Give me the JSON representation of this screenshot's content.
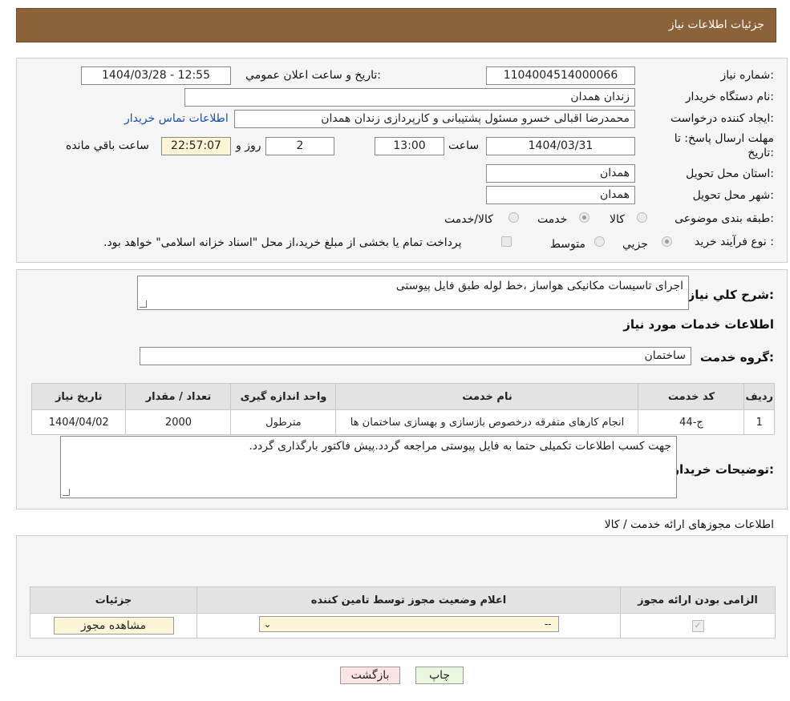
{
  "header": {
    "title": "جزئیات اطلاعات نیاز"
  },
  "info": {
    "need_number_label": "شماره نیاز:",
    "need_number": "1104004514000066",
    "announce_label": "تاریخ و ساعت اعلان عمومي:",
    "announce_value": "1404/03/28 - 12:55",
    "buyer_org_label": "نام دستگاه خريدار:",
    "buyer_org": "زندان همدان",
    "requester_label": "ايجاد کننده درخواست:",
    "requester": "محمدرضا اقبالی خسرو مسئول پشتیبانی و کارپردازی زندان همدان",
    "contact_link": "اطلاعات تماس خريدار",
    "deadline_label_1": "مهلت ارسال پاسخ: تا",
    "deadline_label_2": "تاريخ:",
    "deadline_date": "1404/03/31",
    "time_label": "ساعت",
    "deadline_time": "13:00",
    "days": "2",
    "days_label": "روز و",
    "remaining": "22:57:07",
    "remaining_label": "ساعت باقي مانده",
    "province_label": "استان محل تحويل:",
    "province": "همدان",
    "city_label": "شهر محل تحويل:",
    "city": "همدان",
    "category_label": "طبقه بندی موضوعی:",
    "category_options": [
      "کالا",
      "خدمت",
      "کالا/خدمت"
    ],
    "category_selected": 1,
    "process_label": "نوع فرآيند خريد :",
    "process_options": [
      "جزيي",
      "متوسط"
    ],
    "process_note": "پرداخت تمام يا بخشی از مبلغ خريد،از محل \"اسناد خزانه اسلامی\" خواهد بود."
  },
  "details": {
    "summary_label": "شرح کلي نياز:",
    "summary": "اجرای تاسیسات مکانیکی هواساز ،خط لوله طبق فایل پیوستی",
    "services_title": "اطلاعات خدمات مورد نياز",
    "service_group_label": "گروه خدمت:",
    "service_group": "ساختمان",
    "table": {
      "headers": [
        "رديف",
        "کد خدمت",
        "نام خدمت",
        "واحد اندازه گيری",
        "تعداد / مقدار",
        "تاريخ نياز"
      ],
      "rows": [
        [
          "1",
          "ج-44",
          "انجام کارهای متفرقه درخصوص بازسازی و بهسازی ساختمان ها",
          "مترطول",
          "2000",
          "1404/04/02"
        ]
      ]
    },
    "buyer_notes_label": "توضيحات خريدار:",
    "buyer_notes": "جهت کسب اطلاعات تکمیلی حتما به فایل پیوستی مراجعه گردد.پیش فاکتور بارگذاری گردد."
  },
  "permits": {
    "title": "اطلاعات مجوزهای ارائه خدمت / کالا",
    "headers": [
      "الزامی بودن ارائه مجوز",
      "اعلام وضعيت مجوز توسط تامين کننده",
      "جزئيات"
    ],
    "select_value": "--",
    "view_button": "مشاهده مجوز"
  },
  "buttons": {
    "print": "چاپ",
    "back": "بازگشت"
  },
  "colors": {
    "header_bg": "#8b6239",
    "back_bg": "#fde4e4",
    "print_bg": "#eaf7e0"
  }
}
